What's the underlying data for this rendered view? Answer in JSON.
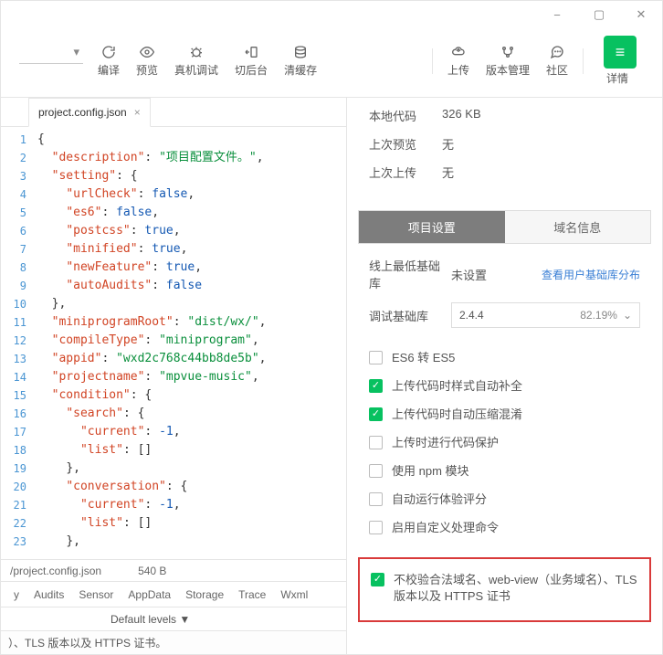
{
  "window": {
    "min": "−",
    "max": "▢",
    "close": "✕"
  },
  "toolbar": {
    "compile": "编译",
    "preview": "预览",
    "remote_debug": "真机调试",
    "back": "切后台",
    "clear_cache": "清缓存",
    "upload": "上传",
    "version": "版本管理",
    "community": "社区",
    "details": "详情"
  },
  "tab": {
    "filename": "project.config.json",
    "close": "×"
  },
  "code": [
    {
      "n": 1,
      "indent": 0,
      "tokens": [
        {
          "t": "punc",
          "v": "{"
        }
      ]
    },
    {
      "n": 2,
      "indent": 1,
      "tokens": [
        {
          "t": "key",
          "v": "\"description\""
        },
        {
          "t": "punc",
          "v": ": "
        },
        {
          "t": "str",
          "v": "\"项目配置文件。\""
        },
        {
          "t": "punc",
          "v": ","
        }
      ]
    },
    {
      "n": 3,
      "indent": 1,
      "tokens": [
        {
          "t": "key",
          "v": "\"setting\""
        },
        {
          "t": "punc",
          "v": ": {"
        }
      ]
    },
    {
      "n": 4,
      "indent": 2,
      "tokens": [
        {
          "t": "key",
          "v": "\"urlCheck\""
        },
        {
          "t": "punc",
          "v": ": "
        },
        {
          "t": "lit",
          "v": "false"
        },
        {
          "t": "punc",
          "v": ","
        }
      ]
    },
    {
      "n": 5,
      "indent": 2,
      "tokens": [
        {
          "t": "key",
          "v": "\"es6\""
        },
        {
          "t": "punc",
          "v": ": "
        },
        {
          "t": "lit",
          "v": "false"
        },
        {
          "t": "punc",
          "v": ","
        }
      ]
    },
    {
      "n": 6,
      "indent": 2,
      "tokens": [
        {
          "t": "key",
          "v": "\"postcss\""
        },
        {
          "t": "punc",
          "v": ": "
        },
        {
          "t": "lit",
          "v": "true"
        },
        {
          "t": "punc",
          "v": ","
        }
      ]
    },
    {
      "n": 7,
      "indent": 2,
      "tokens": [
        {
          "t": "key",
          "v": "\"minified\""
        },
        {
          "t": "punc",
          "v": ": "
        },
        {
          "t": "lit",
          "v": "true"
        },
        {
          "t": "punc",
          "v": ","
        }
      ]
    },
    {
      "n": 8,
      "indent": 2,
      "tokens": [
        {
          "t": "key",
          "v": "\"newFeature\""
        },
        {
          "t": "punc",
          "v": ": "
        },
        {
          "t": "lit",
          "v": "true"
        },
        {
          "t": "punc",
          "v": ","
        }
      ]
    },
    {
      "n": 9,
      "indent": 2,
      "tokens": [
        {
          "t": "key",
          "v": "\"autoAudits\""
        },
        {
          "t": "punc",
          "v": ": "
        },
        {
          "t": "lit",
          "v": "false"
        }
      ]
    },
    {
      "n": 10,
      "indent": 1,
      "tokens": [
        {
          "t": "punc",
          "v": "},"
        }
      ]
    },
    {
      "n": 11,
      "indent": 1,
      "tokens": [
        {
          "t": "key",
          "v": "\"miniprogramRoot\""
        },
        {
          "t": "punc",
          "v": ": "
        },
        {
          "t": "str",
          "v": "\"dist/wx/\""
        },
        {
          "t": "punc",
          "v": ","
        }
      ]
    },
    {
      "n": 12,
      "indent": 1,
      "tokens": [
        {
          "t": "key",
          "v": "\"compileType\""
        },
        {
          "t": "punc",
          "v": ": "
        },
        {
          "t": "str",
          "v": "\"miniprogram\""
        },
        {
          "t": "punc",
          "v": ","
        }
      ]
    },
    {
      "n": 13,
      "indent": 1,
      "tokens": [
        {
          "t": "key",
          "v": "\"appid\""
        },
        {
          "t": "punc",
          "v": ": "
        },
        {
          "t": "str",
          "v": "\"wxd2c768c44bb8de5b\""
        },
        {
          "t": "punc",
          "v": ","
        }
      ]
    },
    {
      "n": 14,
      "indent": 1,
      "tokens": [
        {
          "t": "key",
          "v": "\"projectname\""
        },
        {
          "t": "punc",
          "v": ": "
        },
        {
          "t": "str",
          "v": "\"mpvue-music\""
        },
        {
          "t": "punc",
          "v": ","
        }
      ]
    },
    {
      "n": 15,
      "indent": 1,
      "tokens": [
        {
          "t": "key",
          "v": "\"condition\""
        },
        {
          "t": "punc",
          "v": ": {"
        }
      ]
    },
    {
      "n": 16,
      "indent": 2,
      "tokens": [
        {
          "t": "key",
          "v": "\"search\""
        },
        {
          "t": "punc",
          "v": ": {"
        }
      ]
    },
    {
      "n": 17,
      "indent": 3,
      "tokens": [
        {
          "t": "key",
          "v": "\"current\""
        },
        {
          "t": "punc",
          "v": ": "
        },
        {
          "t": "lit",
          "v": "-1"
        },
        {
          "t": "punc",
          "v": ","
        }
      ]
    },
    {
      "n": 18,
      "indent": 3,
      "tokens": [
        {
          "t": "key",
          "v": "\"list\""
        },
        {
          "t": "punc",
          "v": ": []"
        }
      ]
    },
    {
      "n": 19,
      "indent": 2,
      "tokens": [
        {
          "t": "punc",
          "v": "},"
        }
      ]
    },
    {
      "n": 20,
      "indent": 2,
      "tokens": [
        {
          "t": "key",
          "v": "\"conversation\""
        },
        {
          "t": "punc",
          "v": ": {"
        }
      ]
    },
    {
      "n": 21,
      "indent": 3,
      "tokens": [
        {
          "t": "key",
          "v": "\"current\""
        },
        {
          "t": "punc",
          "v": ": "
        },
        {
          "t": "lit",
          "v": "-1"
        },
        {
          "t": "punc",
          "v": ","
        }
      ]
    },
    {
      "n": 22,
      "indent": 3,
      "tokens": [
        {
          "t": "key",
          "v": "\"list\""
        },
        {
          "t": "punc",
          "v": ": []"
        }
      ]
    },
    {
      "n": 23,
      "indent": 2,
      "tokens": [
        {
          "t": "punc",
          "v": "},"
        }
      ]
    }
  ],
  "status": {
    "path": "/project.config.json",
    "size": "540 B"
  },
  "debug_tabs": [
    "y",
    "Audits",
    "Sensor",
    "AppData",
    "Storage",
    "Trace",
    "Wxml"
  ],
  "debug_levels": "Default levels ▼",
  "debug_msg": "）、TLS 版本以及 HTTPS 证书。",
  "info": {
    "local_code_label": "本地代码",
    "local_code_value": "326 KB",
    "last_preview_label": "上次预览",
    "last_preview_value": "无",
    "last_upload_label": "上次上传",
    "last_upload_value": "无"
  },
  "seg": {
    "project": "项目设置",
    "domain": "域名信息"
  },
  "settings": {
    "online_base_label": "线上最低基础库",
    "online_base_value": "未设置",
    "online_base_link": "查看用户基础库分布",
    "debug_base_label": "调试基础库",
    "debug_base_value": "2.4.4",
    "debug_base_pct": "82.19%"
  },
  "checks": {
    "es6": {
      "checked": false,
      "label": "ES6 转 ES5"
    },
    "style_complete": {
      "checked": true,
      "label": "上传代码时样式自动补全"
    },
    "auto_compress": {
      "checked": true,
      "label": "上传代码时自动压缩混淆"
    },
    "code_protect": {
      "checked": false,
      "label": "上传时进行代码保护"
    },
    "npm": {
      "checked": false,
      "label": "使用 npm 模块"
    },
    "auto_audit": {
      "checked": false,
      "label": "自动运行体验评分"
    },
    "custom_cmd": {
      "checked": false,
      "label": "启用自定义处理命令"
    },
    "skip_verify": {
      "checked": true,
      "label": "不校验合法域名、web-view（业务域名）、TLS 版本以及 HTTPS 证书"
    }
  }
}
